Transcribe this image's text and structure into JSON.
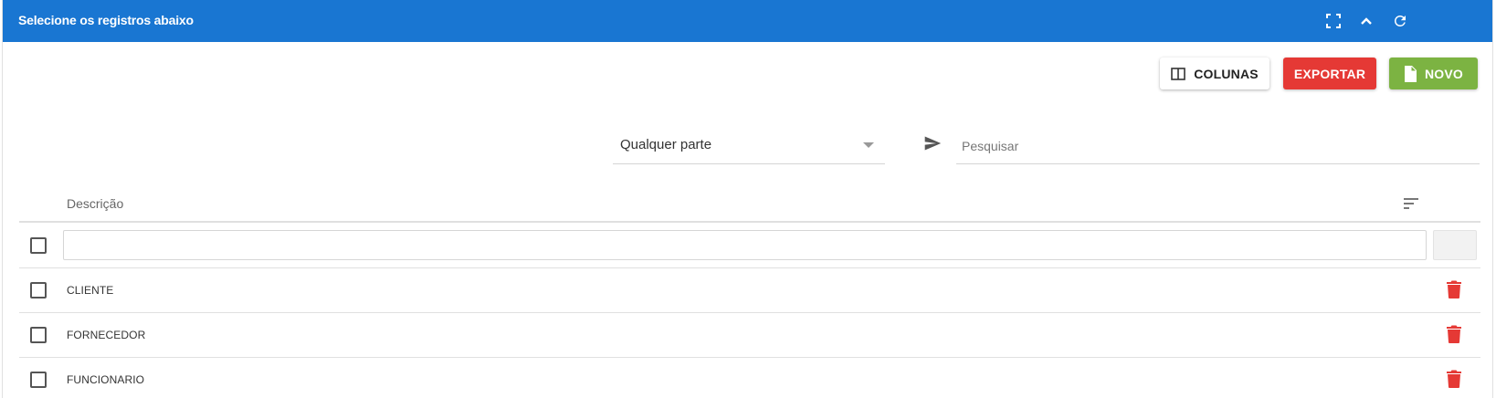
{
  "header": {
    "title": "Selecione os registros abaixo",
    "background": "#1976d2",
    "icons": [
      "fullscreen-icon",
      "chevron-up-icon",
      "refresh-icon"
    ]
  },
  "toolbar": {
    "columns_label": "COLUNAS",
    "export_label": "EXPORTAR",
    "new_label": "NOVO",
    "export_color": "#e53935",
    "new_color": "#7cb342"
  },
  "search": {
    "mode_value": "Qualquer parte",
    "placeholder": "Pesquisar"
  },
  "table": {
    "column_header": "Descrição",
    "rows": [
      {
        "label": "CLIENTE"
      },
      {
        "label": "FORNECEDOR"
      },
      {
        "label": "FUNCIONARIO"
      }
    ],
    "delete_color": "#e53935"
  }
}
